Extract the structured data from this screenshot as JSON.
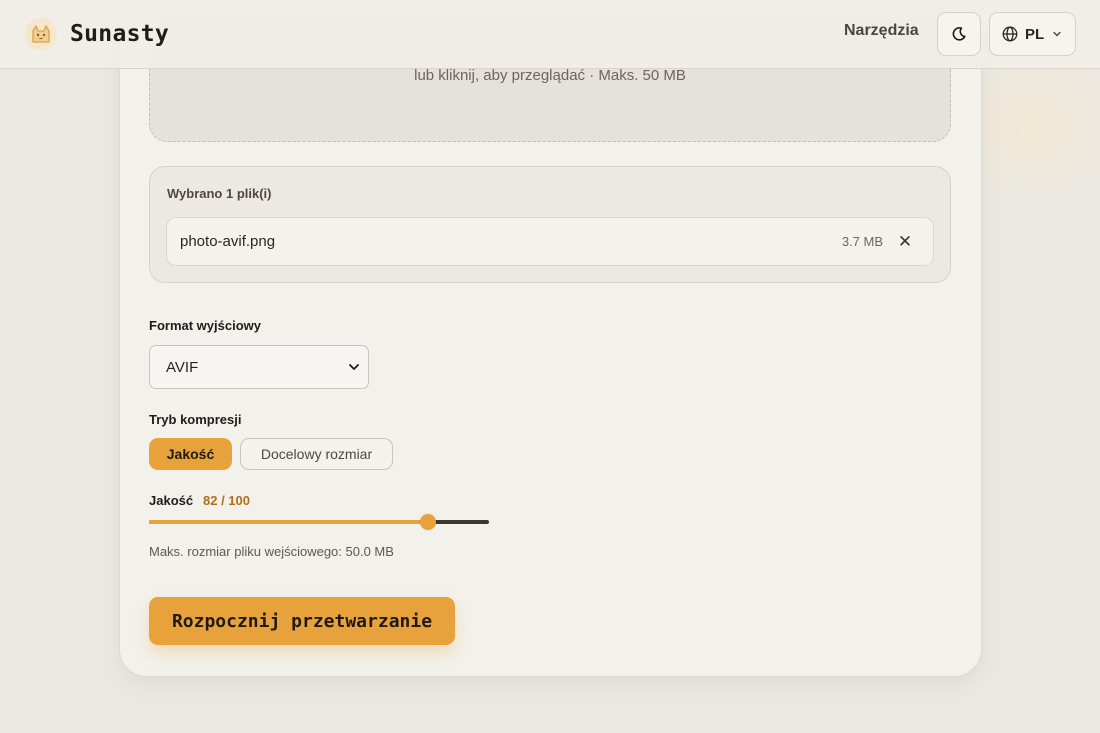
{
  "brand": {
    "name": "Sunasty",
    "logo_icon": "cat-logo-icon"
  },
  "nav": {
    "tools_label": "Narzędzia",
    "theme_icon": "moon-icon",
    "language": {
      "icon": "globe-icon",
      "label": "PL",
      "chevron_icon": "chevron-down-icon"
    }
  },
  "dropzone": {
    "hint": "lub kliknij, aby przeglądać · Maks. 50 MB"
  },
  "files": {
    "title": "Wybrano 1 plik(i)",
    "items": [
      {
        "name": "photo-avif.png",
        "size": "3.7 MB",
        "remove_icon": "close-icon"
      }
    ]
  },
  "output_format": {
    "label": "Format wyjściowy",
    "selected": "AVIF"
  },
  "compression_mode": {
    "label": "Tryb kompresji",
    "options": [
      {
        "label": "Jakość",
        "active": true
      },
      {
        "label": "Docelowy rozmiar",
        "active": false
      }
    ]
  },
  "quality": {
    "label": "Jakość",
    "display": "82 / 100",
    "value": 82,
    "max": 100
  },
  "max_input_size": "Maks. rozmiar pliku wejściowego: 50.0 MB",
  "start_button": "Rozpocznij przetwarzanie",
  "colors": {
    "accent": "#e8a23c",
    "accent_text": "#b46d17",
    "background": "#eae8e3",
    "card": "#f3f1ec"
  }
}
